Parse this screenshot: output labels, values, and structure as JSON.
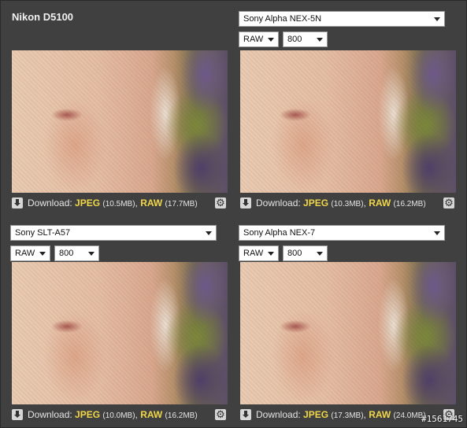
{
  "panels": [
    {
      "camera": "Nikon D5100",
      "format": "",
      "iso": "",
      "download": {
        "label": "Download:",
        "jpeg": "JPEG",
        "jpeg_size": "(10.5MB)",
        "raw": "RAW",
        "raw_size": "(17.7MB)"
      }
    },
    {
      "camera": "Sony Alpha NEX-5N",
      "format": "RAW",
      "iso": "800",
      "download": {
        "label": "Download:",
        "jpeg": "JPEG",
        "jpeg_size": "(10.3MB)",
        "raw": "RAW",
        "raw_size": "(16.2MB)"
      }
    },
    {
      "camera": "Sony SLT-A57",
      "format": "RAW",
      "iso": "800",
      "download": {
        "label": "Download:",
        "jpeg": "JPEG",
        "jpeg_size": "(10.0MB)",
        "raw": "RAW",
        "raw_size": "(16.2MB)"
      }
    },
    {
      "camera": "Sony Alpha NEX-7",
      "format": "RAW",
      "iso": "800",
      "download": {
        "label": "Download:",
        "jpeg": "JPEG",
        "jpeg_size": "(17.3MB)",
        "raw": "RAW",
        "raw_size": "(24.0MB)"
      }
    }
  ],
  "watermark": "#1561745",
  "colors": {
    "background": "#404040",
    "link": "#f0d64a",
    "text": "#e4e4e4"
  },
  "icons": {
    "download": "download-icon",
    "settings": "gear-icon",
    "dropdown": "chevron-down-icon"
  }
}
